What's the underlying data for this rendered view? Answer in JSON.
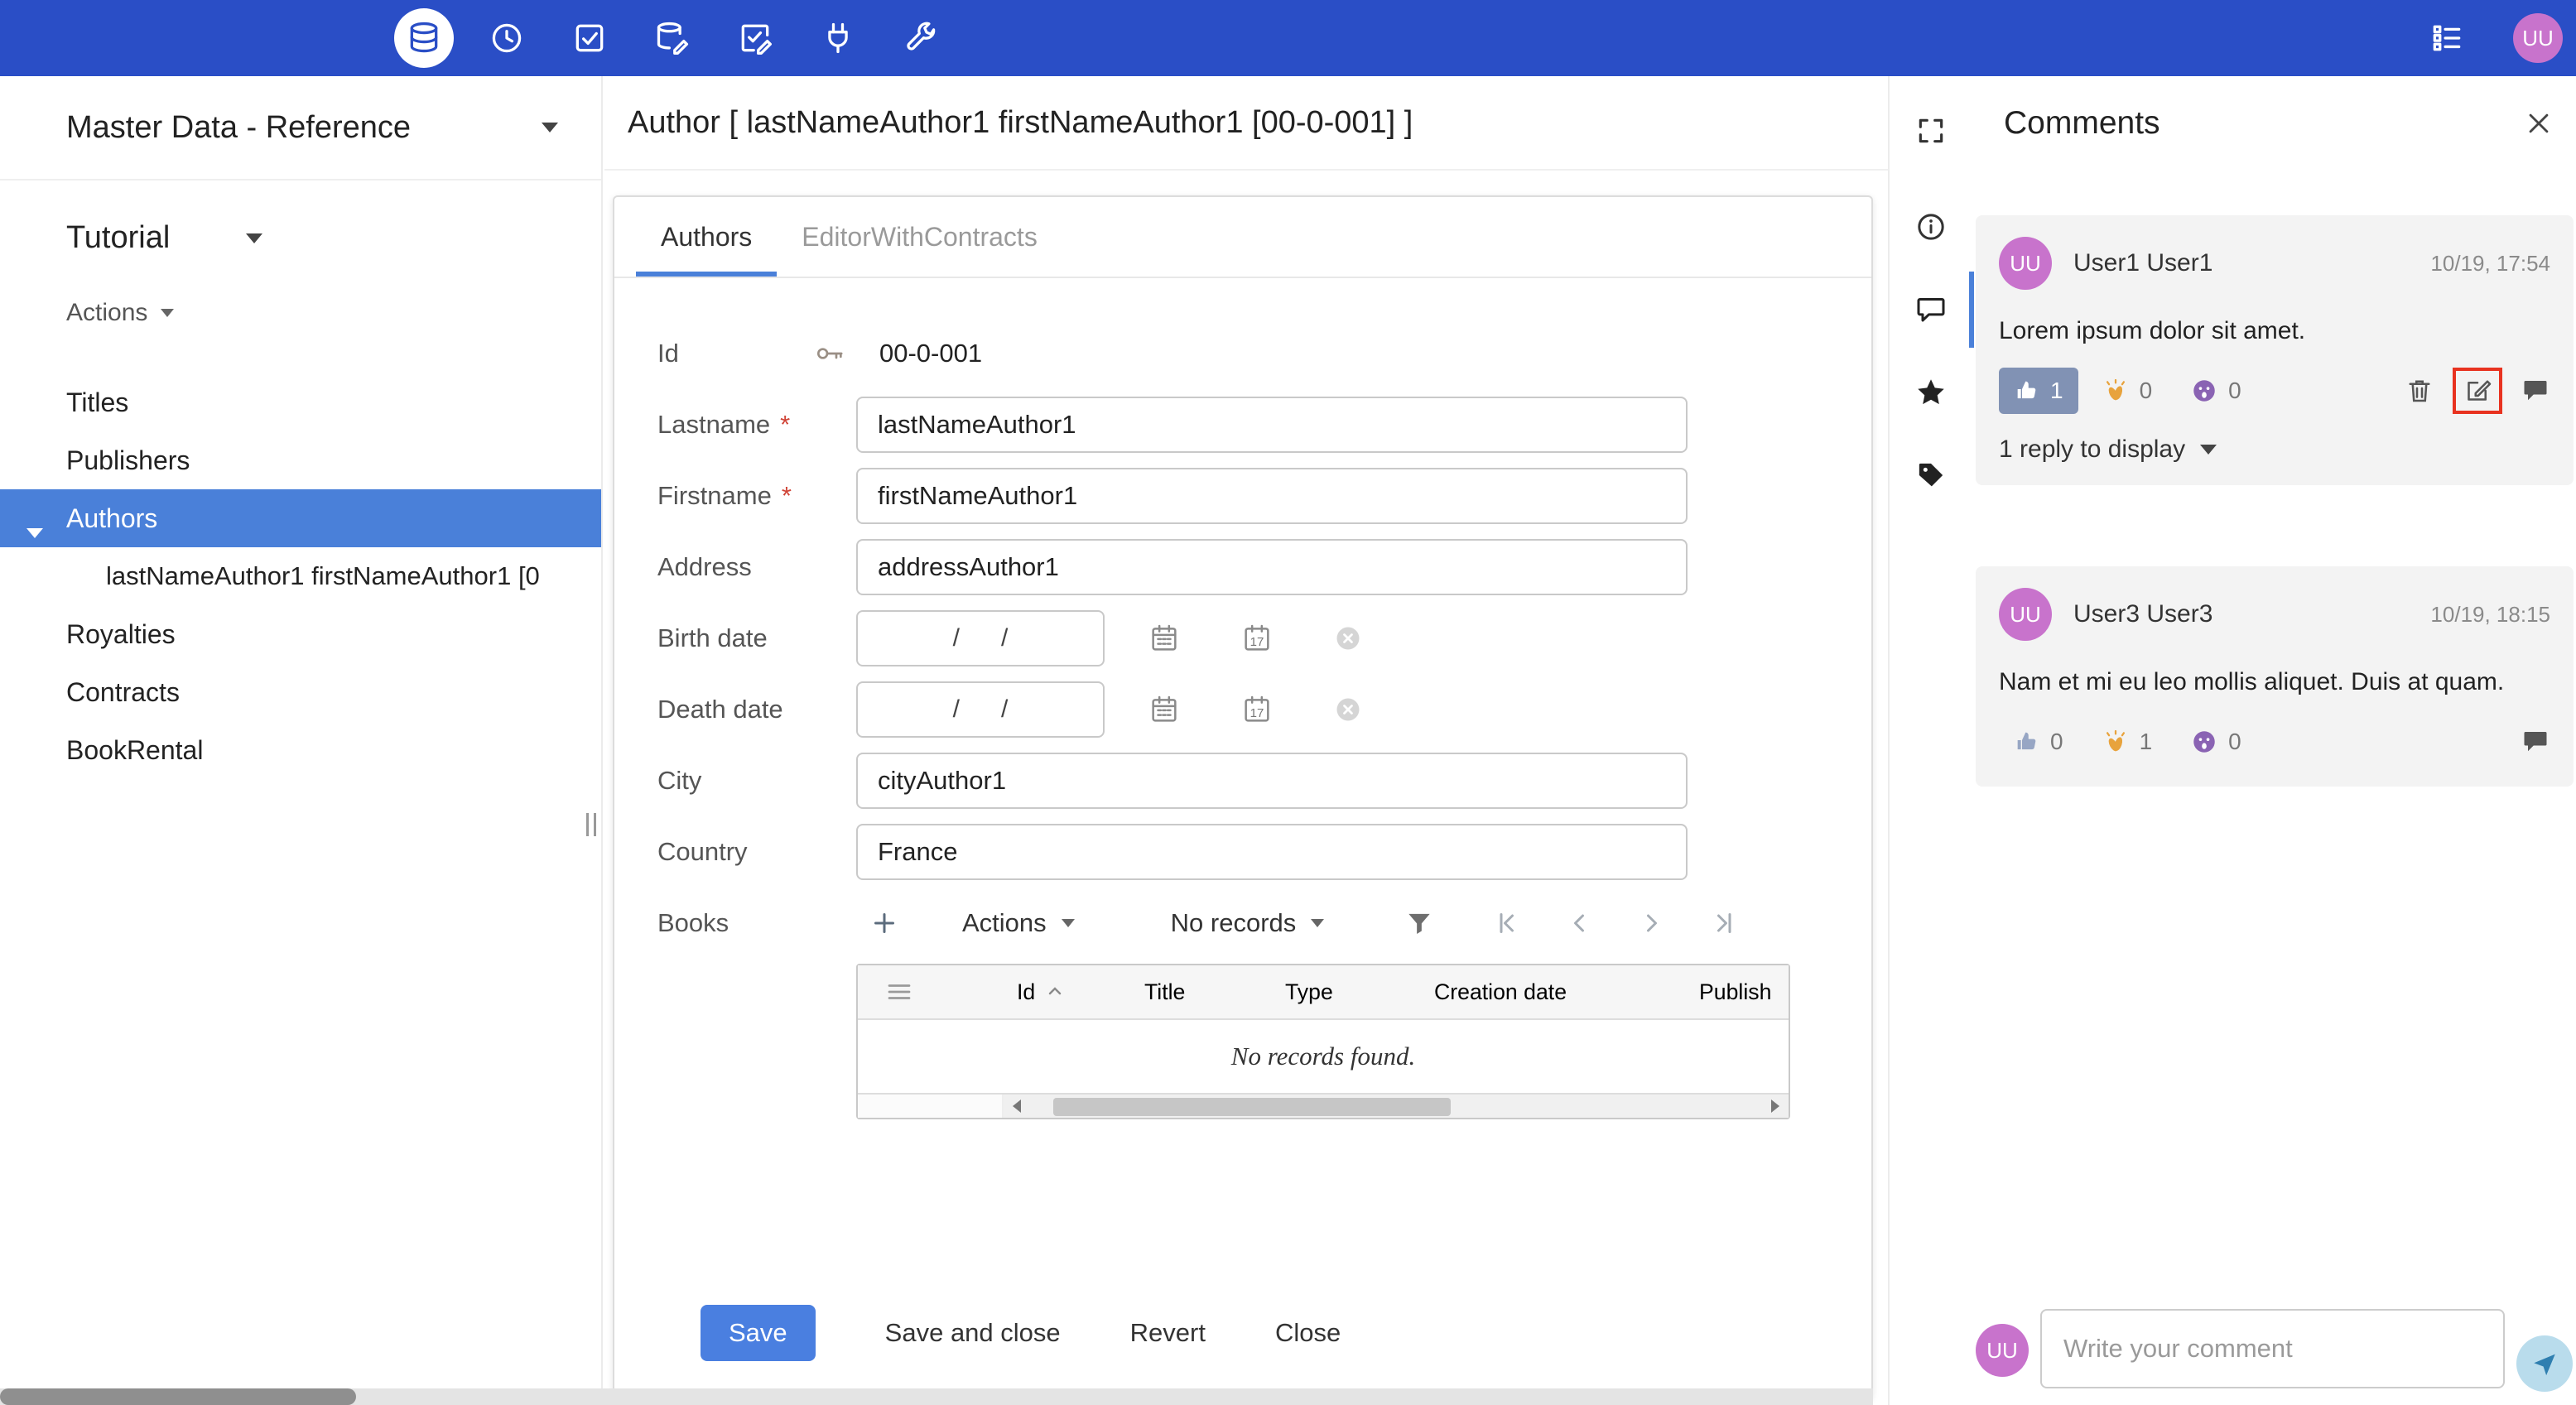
{
  "topbar": {
    "avatar_initials": "UU"
  },
  "sidebar": {
    "workspace_label": "Master Data - Reference",
    "app_label": "Tutorial",
    "actions_label": "Actions",
    "items": [
      {
        "label": "Titles"
      },
      {
        "label": "Publishers"
      },
      {
        "label": "Authors"
      },
      {
        "label": "lastNameAuthor1 firstNameAuthor1 [0"
      },
      {
        "label": "Royalties"
      },
      {
        "label": "Contracts"
      },
      {
        "label": "BookRental"
      }
    ]
  },
  "main": {
    "title": "Author [ lastNameAuthor1 firstNameAuthor1 [00-0-001] ]",
    "tabs": [
      {
        "label": "Authors"
      },
      {
        "label": "EditorWithContracts"
      }
    ],
    "form": {
      "required_mark": "*",
      "id_label": "Id",
      "id_value": "00-0-001",
      "lastname_label": "Lastname",
      "lastname_value": "lastNameAuthor1",
      "firstname_label": "Firstname",
      "firstname_value": "firstNameAuthor1",
      "address_label": "Address",
      "address_value": "addressAuthor1",
      "birth_date_label": "Birth date",
      "death_date_label": "Death date",
      "date_placeholder": "/      /",
      "calendar_day": "17",
      "city_label": "City",
      "city_value": "cityAuthor1",
      "country_label": "Country",
      "country_value": "France"
    },
    "books": {
      "label": "Books",
      "actions_label": "Actions",
      "records_label": "No records",
      "columns": [
        "Id",
        "Title",
        "Type",
        "Creation date",
        "Publish"
      ],
      "empty_text": "No records found."
    },
    "buttons": {
      "save": "Save",
      "save_and_close": "Save and close",
      "revert": "Revert",
      "close": "Close"
    }
  },
  "comments": {
    "title": "Comments",
    "items": [
      {
        "initials": "UU",
        "author": "User1 User1",
        "timestamp": "10/19, 17:54",
        "text": "Lorem ipsum dolor sit amet.",
        "like_count": "1",
        "clap_count": "0",
        "wow_count": "0",
        "reply_toggle": "1 reply to display"
      },
      {
        "initials": "UU",
        "author": "User3 User3",
        "timestamp": "10/19, 18:15",
        "text": "Nam et mi eu leo mollis aliquet. Duis at quam.",
        "like_count": "0",
        "clap_count": "1",
        "wow_count": "0"
      }
    ],
    "composer": {
      "initials": "UU",
      "placeholder": "Write your comment"
    }
  },
  "icons": {
    "database-icon": "cylinder-stack",
    "history-icon": "clock",
    "tasks-icon": "check-square",
    "data-edit-icon": "cylinder-pencil",
    "form-edit-icon": "check-square-pencil",
    "plug-icon": "plug",
    "wrench-icon": "wrench",
    "list-icon": "list-rows",
    "key-icon": "key",
    "calendar-icon": "calendar-grid",
    "calendar-day-icon": "calendar-17",
    "clear-icon": "circle-x",
    "filter-icon": "funnel",
    "expand-icon": "corner-brackets",
    "info-icon": "circle-i",
    "comments-icon": "speech-bubble",
    "star-icon": "star",
    "tag-icon": "tag",
    "close-icon": "x",
    "trash-icon": "trash-can",
    "edit-icon": "pencil-square",
    "reply-icon": "speech-bubble",
    "like-icon": "thumbs-up",
    "clap-icon": "clapping-hands",
    "wow-icon": "astonished-face",
    "send-icon": "paper-plane"
  },
  "colors": {
    "topbar": "#2a4ec6",
    "accent": "#4a80d9",
    "save": "#4a7fe0",
    "avatar": "#c873cc",
    "chip": "#8192b4",
    "red": "#e8321f",
    "send_bg": "#b9dcec",
    "send_fg": "#2f7fb0"
  }
}
